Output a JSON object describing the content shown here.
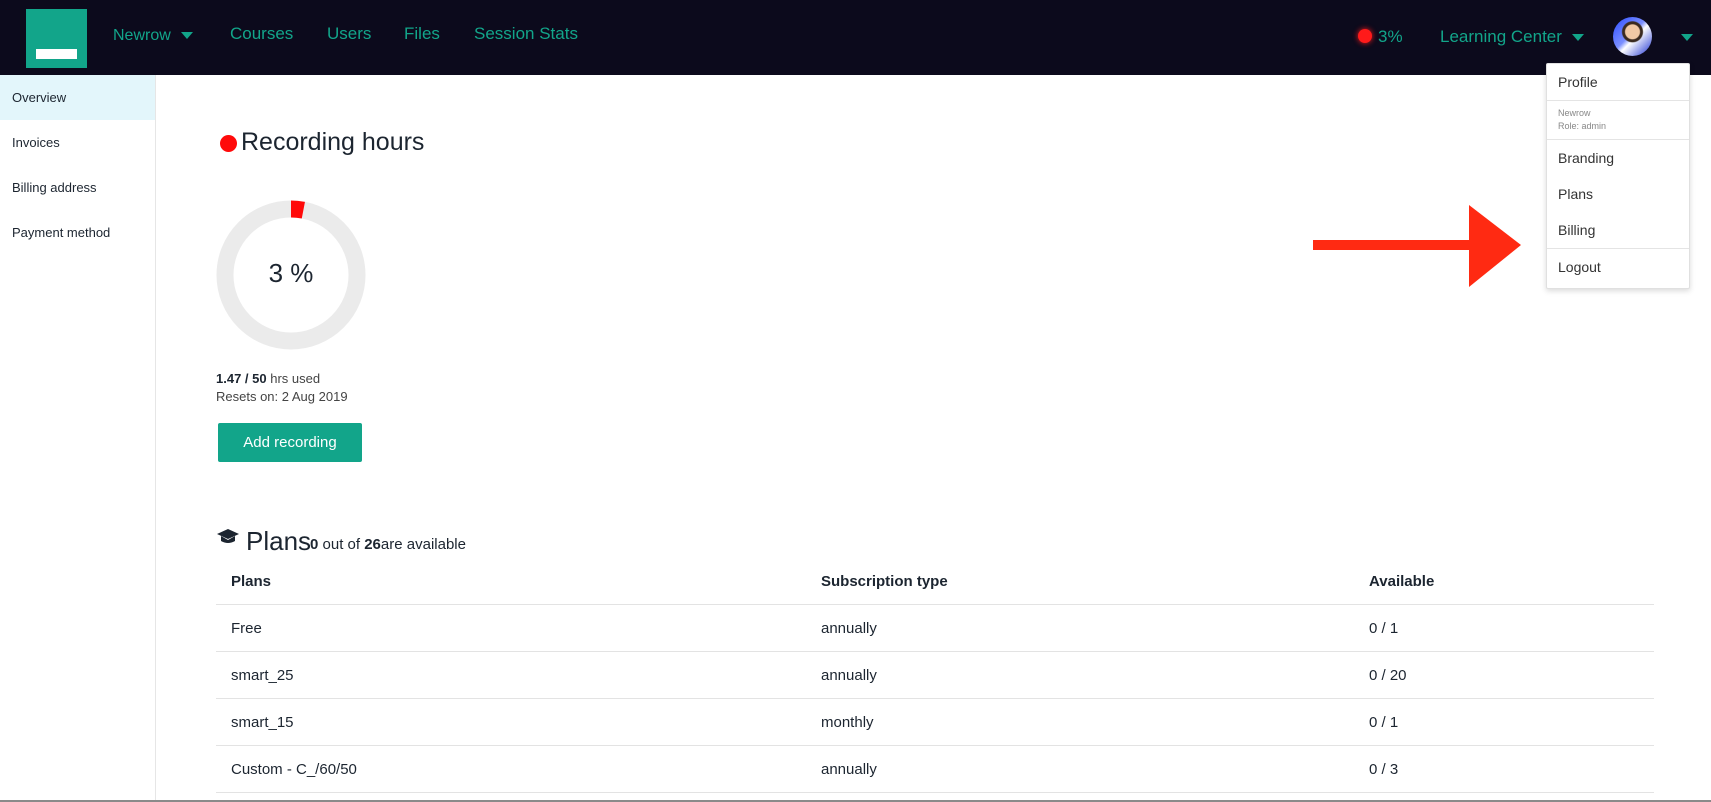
{
  "nav": {
    "org": "Newrow",
    "courses": "Courses",
    "users": "Users",
    "files": "Files",
    "session_stats": "Session Stats",
    "recording_percent": "3%",
    "learning_center": "Learning Center"
  },
  "sidebar": {
    "items": [
      {
        "label": "Overview",
        "active": true
      },
      {
        "label": "Invoices"
      },
      {
        "label": "Billing address"
      },
      {
        "label": "Payment method"
      }
    ]
  },
  "recording": {
    "title": "Recording hours",
    "percent_label": "3 %",
    "percent_value": 3,
    "used_label": "1.47 / 50",
    "used_suffix": "hrs used",
    "resets": "Resets on: 2 Aug 2019",
    "add_button": "Add recording"
  },
  "plans": {
    "title": "Plans",
    "available_count": "0",
    "out_of": "out of",
    "total": "26",
    "are_available": "are available",
    "columns": [
      "Plans",
      "Subscription type",
      "Available"
    ],
    "rows": [
      [
        "Free",
        "annually",
        "0 / 1"
      ],
      [
        "smart_25",
        "annually",
        "0 / 20"
      ],
      [
        "smart_15",
        "monthly",
        "0 / 1"
      ],
      [
        "Custom - C_/60/50",
        "annually",
        "0 / 3"
      ]
    ]
  },
  "user_menu": {
    "profile": "Profile",
    "org_name": "Newrow",
    "role": "Role: admin",
    "branding": "Branding",
    "plans": "Plans",
    "billing": "Billing",
    "logout": "Logout"
  },
  "colors": {
    "brand": "#12a58a",
    "topbar": "#0c0a1c",
    "recording": "#ff0a0a",
    "annotation_arrow": "#ff2a12"
  }
}
